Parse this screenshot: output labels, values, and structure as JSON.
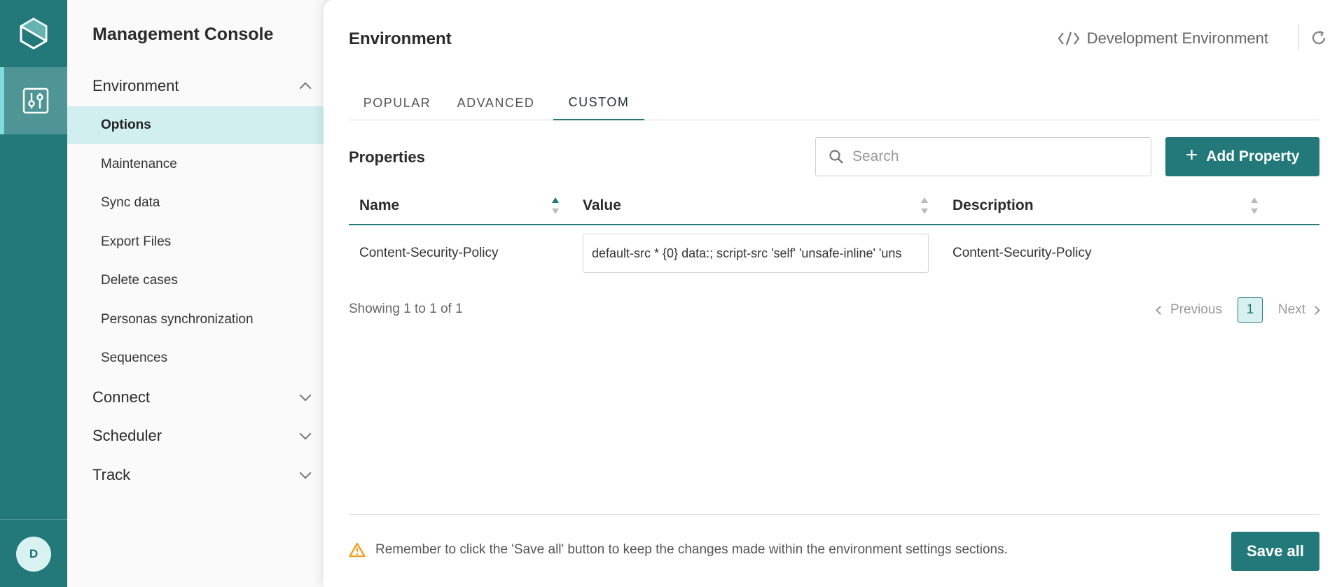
{
  "rail": {
    "logo_icon": "hexagon-logo-icon",
    "active_item_icon": "sliders-icon",
    "avatar_initial": "D"
  },
  "sidebar": {
    "title": "Management Console",
    "groups": [
      {
        "label": "Environment",
        "expanded": true,
        "items": [
          {
            "label": "Options",
            "active": true
          },
          {
            "label": "Maintenance"
          },
          {
            "label": "Sync data"
          },
          {
            "label": "Export Files"
          },
          {
            "label": "Delete cases"
          },
          {
            "label": "Personas synchronization"
          },
          {
            "label": "Sequences"
          }
        ]
      },
      {
        "label": "Connect",
        "expanded": false
      },
      {
        "label": "Scheduler",
        "expanded": false
      },
      {
        "label": "Track",
        "expanded": false
      }
    ]
  },
  "header": {
    "title": "Environment",
    "environment_label": "Development Environment",
    "environment_icon": "code-icon",
    "refresh_icon": "refresh-icon"
  },
  "tabs": [
    {
      "label": "POPULAR"
    },
    {
      "label": "ADVANCED"
    },
    {
      "label": "CUSTOM",
      "active": true
    }
  ],
  "properties": {
    "title": "Properties",
    "search_placeholder": "Search",
    "add_button_label": "Add Property",
    "columns": [
      {
        "label": "Name",
        "sort": "asc"
      },
      {
        "label": "Value",
        "sort": "none"
      },
      {
        "label": "Description",
        "sort": "none"
      }
    ],
    "rows": [
      {
        "name": "Content-Security-Policy",
        "value": "default-src * {0} data:; script-src 'self' 'unsafe-inline' 'uns",
        "description": "Content-Security-Policy"
      }
    ],
    "showing": "Showing 1 to 1 of 1",
    "pagination": {
      "previous": "Previous",
      "current": "1",
      "next": "Next"
    }
  },
  "footer": {
    "notice": "Remember to click the 'Save all' button to keep the changes made within the environment settings sections.",
    "notice_icon": "warning-icon",
    "save_button_label": "Save all"
  },
  "colors": {
    "brand": "#23797a",
    "active_bg": "#d1efef",
    "warning": "#f0a020"
  }
}
